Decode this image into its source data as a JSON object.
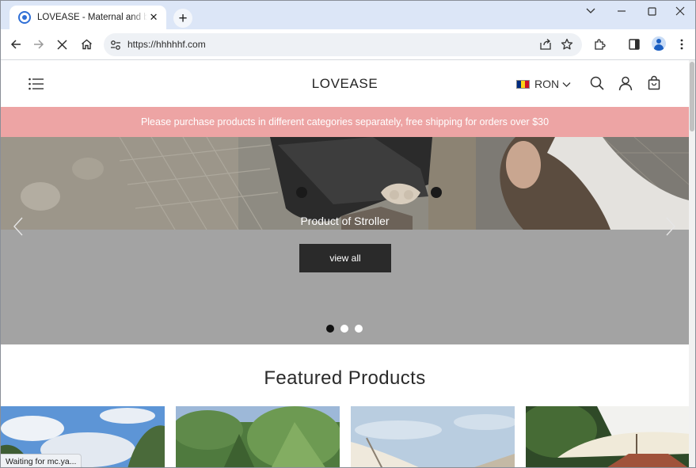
{
  "browser": {
    "tab": {
      "title": "LOVEASE - Maternal and baby p",
      "favicon": "chrome-site-icon",
      "close_glyph": "✕"
    },
    "new_tab_glyph": "+",
    "window_controls": [
      "chevron-down-icon",
      "minimize-icon",
      "maximize-icon",
      "close-icon"
    ],
    "address_bar": {
      "url": "https://hhhhhf.com"
    },
    "toolbar_icons": [
      "back-arrow-icon",
      "forward-arrow-icon",
      "stop-loading-icon",
      "home-icon",
      "site-settings-icon",
      "share-icon",
      "bookmark-star-icon",
      "extensions-icon",
      "side-panel-icon",
      "profile-avatar-icon",
      "more-menu-icon"
    ],
    "status_text": "Waiting for mc.ya..."
  },
  "site": {
    "logo": "LOVEASE",
    "currency": {
      "label": "RON",
      "flag_colors": [
        "#002b7f",
        "#fcd116",
        "#ce1126"
      ]
    },
    "header_icons": [
      "hamburger-menu-icon",
      "search-icon",
      "account-icon",
      "cart-bag-icon"
    ],
    "announcement": "Please purchase products in different categories separately, free shipping for orders over $30",
    "announcement_bg": "#eda4a4",
    "hero": {
      "caption": "Product of Stroller",
      "button_label": "view all",
      "slide_count": 3,
      "active_slide": 1
    },
    "featured_title": "Featured Products",
    "products": [
      {
        "image": "sky-and-trees-photo"
      },
      {
        "image": "palm-garden-photo"
      },
      {
        "image": "beach-umbrella-photo"
      },
      {
        "image": "patio-umbrella-photo"
      }
    ]
  }
}
